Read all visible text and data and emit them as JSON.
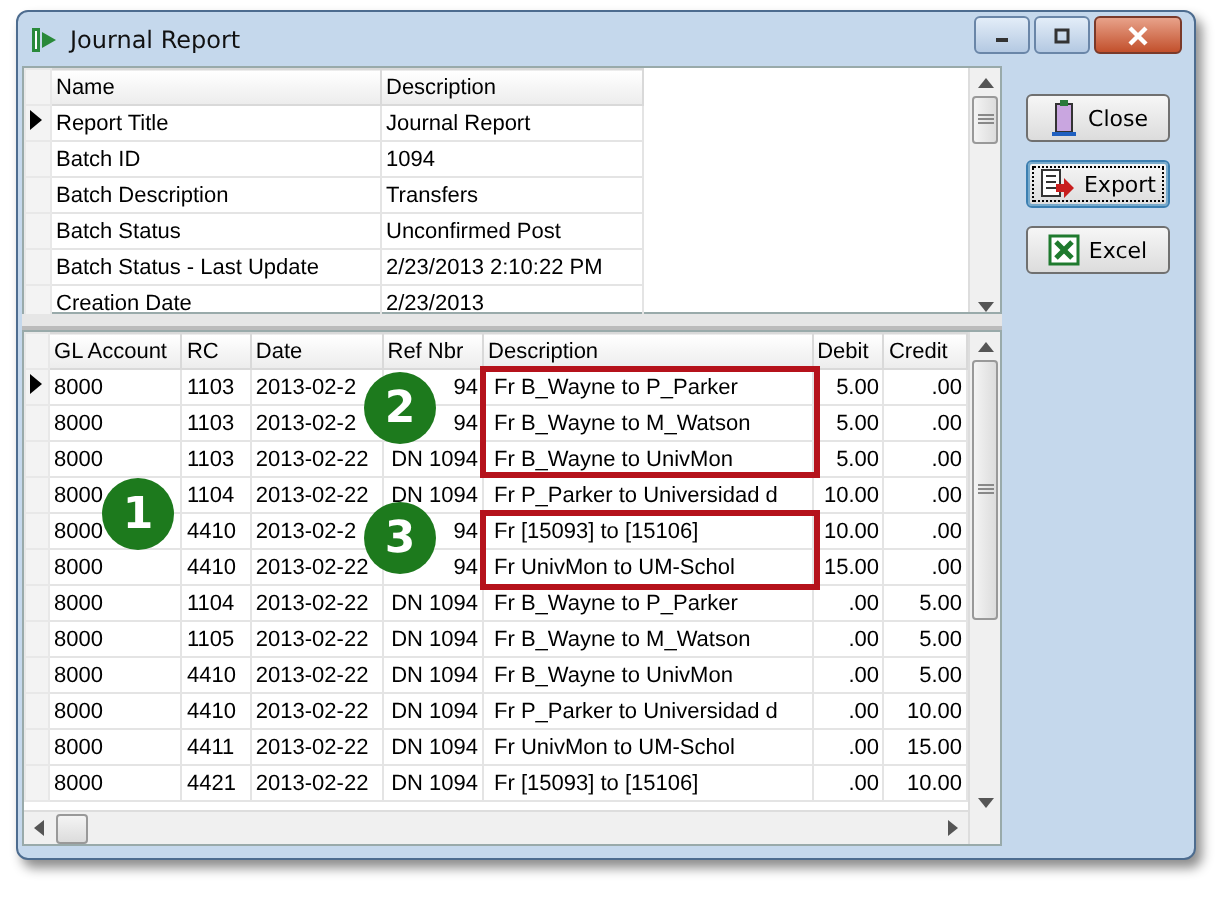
{
  "window": {
    "title": "Journal Report"
  },
  "summary": {
    "columns": [
      "Name",
      "Description"
    ],
    "rows": [
      {
        "name": "Report Title",
        "value": "Journal Report",
        "selected": true
      },
      {
        "name": "Batch ID",
        "value": "1094",
        "selected": false
      },
      {
        "name": "Batch Description",
        "value": "Transfers",
        "selected": false
      },
      {
        "name": "Batch Status",
        "value": "Unconfirmed Post",
        "selected": false
      },
      {
        "name": "Batch Status - Last Update",
        "value": "2/23/2013 2:10:22 PM",
        "selected": false
      },
      {
        "name": "Creation Date",
        "value": "2/23/2013",
        "selected": false
      }
    ]
  },
  "buttons": [
    {
      "label": "Close",
      "kind": "close",
      "focused": false
    },
    {
      "label": "Export",
      "kind": "export",
      "focused": true
    },
    {
      "label": "Excel",
      "kind": "excel",
      "focused": false
    }
  ],
  "details": {
    "columns": [
      "GL Account",
      "RC",
      "Date",
      "Ref Nbr",
      "Description",
      "Debit",
      "Credit"
    ],
    "rows": [
      {
        "cells": [
          "8000",
          "1103",
          "2013-02-2",
          "94",
          "Fr B_Wayne to P_Parker",
          "5.00",
          ".00"
        ],
        "selected": true
      },
      {
        "cells": [
          "8000",
          "1103",
          "2013-02-2",
          "94",
          "Fr B_Wayne to M_Watson",
          "5.00",
          ".00"
        ],
        "selected": false
      },
      {
        "cells": [
          "8000",
          "1103",
          "2013-02-22",
          "DN 1094",
          "Fr B_Wayne to UnivMon",
          "5.00",
          ".00"
        ],
        "selected": false
      },
      {
        "cells": [
          "8000",
          "1104",
          "2013-02-22",
          "DN 1094",
          "Fr P_Parker to Universidad d",
          "10.00",
          ".00"
        ],
        "selected": false
      },
      {
        "cells": [
          "8000",
          "4410",
          "2013-02-2",
          "94",
          "Fr [15093] to [15106]",
          "10.00",
          ".00"
        ],
        "selected": false
      },
      {
        "cells": [
          "8000",
          "4410",
          "2013-02-22",
          "94",
          "Fr UnivMon to UM-Schol",
          "15.00",
          ".00"
        ],
        "selected": false
      },
      {
        "cells": [
          "8000",
          "1104",
          "2013-02-22",
          "DN 1094",
          "Fr B_Wayne to P_Parker",
          ".00",
          "5.00"
        ],
        "selected": false
      },
      {
        "cells": [
          "8000",
          "1105",
          "2013-02-22",
          "DN 1094",
          "Fr B_Wayne to M_Watson",
          ".00",
          "5.00"
        ],
        "selected": false
      },
      {
        "cells": [
          "8000",
          "4410",
          "2013-02-22",
          "DN 1094",
          "Fr B_Wayne to UnivMon",
          ".00",
          "5.00"
        ],
        "selected": false
      },
      {
        "cells": [
          "8000",
          "4410",
          "2013-02-22",
          "DN 1094",
          "Fr P_Parker to Universidad d",
          ".00",
          "10.00"
        ],
        "selected": false
      },
      {
        "cells": [
          "8000",
          "4411",
          "2013-02-22",
          "DN 1094",
          "Fr UnivMon to UM-Schol",
          ".00",
          "15.00"
        ],
        "selected": false
      },
      {
        "cells": [
          "8000",
          "4421",
          "2013-02-22",
          "DN 1094",
          "Fr [15093] to [15106]",
          ".00",
          "10.00"
        ],
        "selected": false
      }
    ]
  },
  "callouts": [
    {
      "number": "1"
    },
    {
      "number": "2"
    },
    {
      "number": "3"
    }
  ]
}
